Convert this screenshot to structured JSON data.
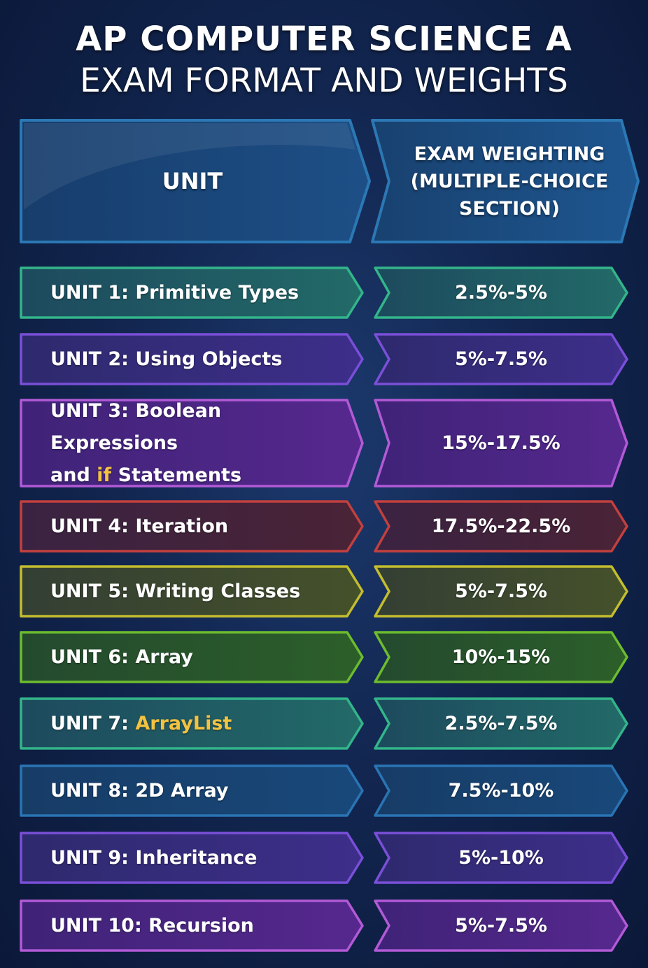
{
  "title": {
    "line1": "AP COMPUTER SCIENCE A",
    "line2": "EXAM FORMAT AND WEIGHTS"
  },
  "header": {
    "unit_label": "UNIT",
    "weight_line1": "EXAM WEIGHTING",
    "weight_line2": "(MULTIPLE-CHOICE",
    "weight_line3": "SECTION)"
  },
  "colors": {
    "highlight": "#f3c241",
    "header_border": "#2b78b4"
  },
  "rows": [
    {
      "prefix": "UNIT 1: ",
      "name_a": "Primitive Types",
      "highlight": "",
      "name_b": "",
      "weight": "2.5%-5%",
      "fill_l": "#1d4a5e",
      "fill_r": "#226a68",
      "border": "#33b58a"
    },
    {
      "prefix": "UNIT 2: ",
      "name_a": "Using Objects",
      "highlight": "",
      "name_b": "",
      "weight": "5%-7.5%",
      "fill_l": "#2e2a6e",
      "fill_r": "#3d2e8a",
      "border": "#7a4fd8"
    },
    {
      "prefix": "UNIT 3: ",
      "name_a": "Boolean Expressions",
      "line2_a": "and ",
      "highlight": "if",
      "name_b": " Statements",
      "weight": "15%-17.5%",
      "fill_l": "#3f2378",
      "fill_r": "#56288e",
      "border": "#b25ad6"
    },
    {
      "prefix": "UNIT 4: ",
      "name_a": "Iteration",
      "highlight": "",
      "name_b": "",
      "weight": "17.5%-22.5%",
      "fill_l": "#3a2342",
      "fill_r": "#4a2336",
      "border": "#c2403e"
    },
    {
      "prefix": "UNIT 5: ",
      "name_a": "Writing Classes",
      "highlight": "",
      "name_b": "",
      "weight": "5%-7.5%",
      "fill_l": "#343f34",
      "fill_r": "#45512a",
      "border": "#c3bd2f"
    },
    {
      "prefix": "UNIT 6: ",
      "name_a": "Array",
      "highlight": "",
      "name_b": "",
      "weight": "10%-15%",
      "fill_l": "#244a2e",
      "fill_r": "#2c5f2a",
      "border": "#6dbc2e"
    },
    {
      "prefix": "UNIT 7: ",
      "name_a": "",
      "highlight": "ArrayList",
      "name_b": "",
      "weight": "2.5%-7.5%",
      "fill_l": "#1d4a5e",
      "fill_r": "#226a68",
      "border": "#33b58a"
    },
    {
      "prefix": "UNIT 8: ",
      "name_a": "2D Array",
      "highlight": "",
      "name_b": "",
      "weight": "7.5%-10%",
      "fill_l": "#173c66",
      "fill_r": "#18487a",
      "border": "#2a74b4"
    },
    {
      "prefix": "UNIT 9:  ",
      "name_a": "Inheritance",
      "highlight": "",
      "name_b": "",
      "weight": "5%-10%",
      "fill_l": "#2e2a6e",
      "fill_r": "#3d2e8a",
      "border": "#7a4fd8"
    },
    {
      "prefix": "UNIT 10:  ",
      "name_a": "Recursion",
      "highlight": "",
      "name_b": "",
      "weight": "5%-7.5%",
      "fill_l": "#3f2378",
      "fill_r": "#56288e",
      "border": "#b25ad6"
    }
  ]
}
